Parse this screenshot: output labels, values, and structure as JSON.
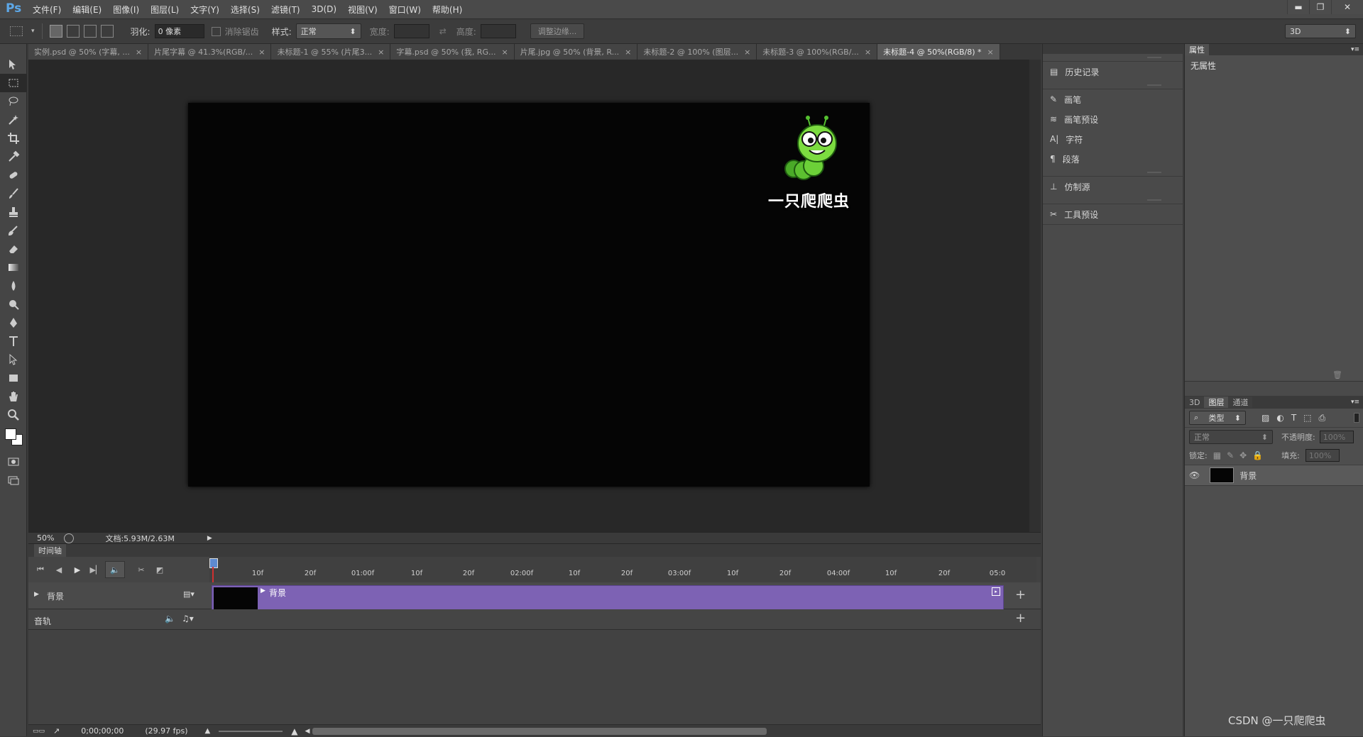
{
  "app": {
    "logo": "Ps",
    "brand_color": "#5da8e8"
  },
  "menu": [
    "文件(F)",
    "编辑(E)",
    "图像(I)",
    "图层(L)",
    "文字(Y)",
    "选择(S)",
    "滤镜(T)",
    "3D(D)",
    "视图(V)",
    "窗口(W)",
    "帮助(H)"
  ],
  "window_controls": {
    "minimize": "▬",
    "restore": "❐",
    "close": "✕"
  },
  "options": {
    "feather_label": "羽化:",
    "feather_value": "0 像素",
    "antialias_label": "消除锯齿",
    "style_label": "样式:",
    "style_value": "正常",
    "width_label": "宽度:",
    "height_label": "高度:",
    "refine_edge_button": "调整边缘...",
    "workspace_value": "3D"
  },
  "tabs": [
    {
      "label": "实例.psd @ 50% (字幕, ..."
    },
    {
      "label": "片尾字幕 @ 41.3%(RGB/..."
    },
    {
      "label": "未标题-1 @ 55% (片尾3..."
    },
    {
      "label": "字幕.psd @ 50% (我, RG..."
    },
    {
      "label": "片尾.jpg @ 50% (背景, R..."
    },
    {
      "label": "未标题-2 @ 100% (图层..."
    },
    {
      "label": "未标题-3 @ 100%(RGB/..."
    },
    {
      "label": "未标题-4 @ 50%(RGB/8) *",
      "active": true
    }
  ],
  "canvas": {
    "logo_text": "一只爬爬虫"
  },
  "status": {
    "zoom": "50%",
    "doc_info": "文档:5.93M/2.63M"
  },
  "timeline": {
    "title": "时间轴",
    "ticks": [
      "10f",
      "20f",
      "01:00f",
      "10f",
      "20f",
      "02:00f",
      "10f",
      "20f",
      "03:00f",
      "10f",
      "20f",
      "04:00f",
      "10f",
      "20f",
      "05:0"
    ],
    "track_label": "背景",
    "clip_label": "背景",
    "audio_label": "音轨",
    "timecode": "0;00;00;00",
    "fps": "(29.97 fps)",
    "clip_color": "#7d62b4"
  },
  "dock": {
    "items": [
      {
        "label": "历史记录",
        "icon": "history-icon"
      },
      {
        "label": "画笔",
        "icon": "brush-icon"
      },
      {
        "label": "画笔预设",
        "icon": "brush-preset-icon"
      },
      {
        "label": "字符",
        "icon": "character-icon"
      },
      {
        "label": "段落",
        "icon": "paragraph-icon"
      },
      {
        "label": "仿制源",
        "icon": "clone-source-icon"
      },
      {
        "label": "工具预设",
        "icon": "tool-preset-icon"
      }
    ]
  },
  "properties": {
    "tab": "属性",
    "content": "无属性"
  },
  "layers_panel": {
    "tabs": [
      "3D",
      "图层",
      "通道"
    ],
    "filter_kind": "类型",
    "blend_mode": "正常",
    "opacity_label": "不透明度:",
    "opacity_value": "100%",
    "lock_label": "锁定:",
    "fill_label": "填充:",
    "fill_value": "100%",
    "layer_name": "背景"
  },
  "watermark": "CSDN @一只爬爬虫"
}
